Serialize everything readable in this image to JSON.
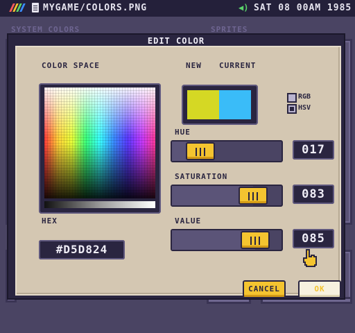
{
  "topbar": {
    "filename": "MYGAME/COLORS.PNG",
    "clock": "SAT 08 00AM 1985",
    "icons": [
      "logo-icon",
      "file-icon",
      "speaker-icon"
    ]
  },
  "background": {
    "left_label": "SYSTEM COLORS",
    "right_label": "SPRITES"
  },
  "dialog": {
    "title": "EDIT COLOR",
    "color_space_label": "COLOR SPACE",
    "new_label": "NEW",
    "current_label": "CURRENT",
    "new_color": "#D5D824",
    "current_color": "#3ABCF8",
    "mode_options": [
      {
        "label": "RGB",
        "selected": false
      },
      {
        "label": "HSV",
        "selected": true
      }
    ],
    "hue": {
      "label": "HUE",
      "value": "017",
      "level": 0.17
    },
    "saturation": {
      "label": "SATURATION",
      "value": "083",
      "level": 0.83
    },
    "value": {
      "label": "VALUE",
      "value": "085",
      "level": 0.85
    },
    "hex_label": "HEX",
    "hex_value": "#D5D824",
    "cancel_label": "CANCEL",
    "ok_label": "OK"
  },
  "colors": {
    "accent": "#F4C430",
    "dialog_bg": "#D4C7B2",
    "frame": "#2A2540"
  }
}
